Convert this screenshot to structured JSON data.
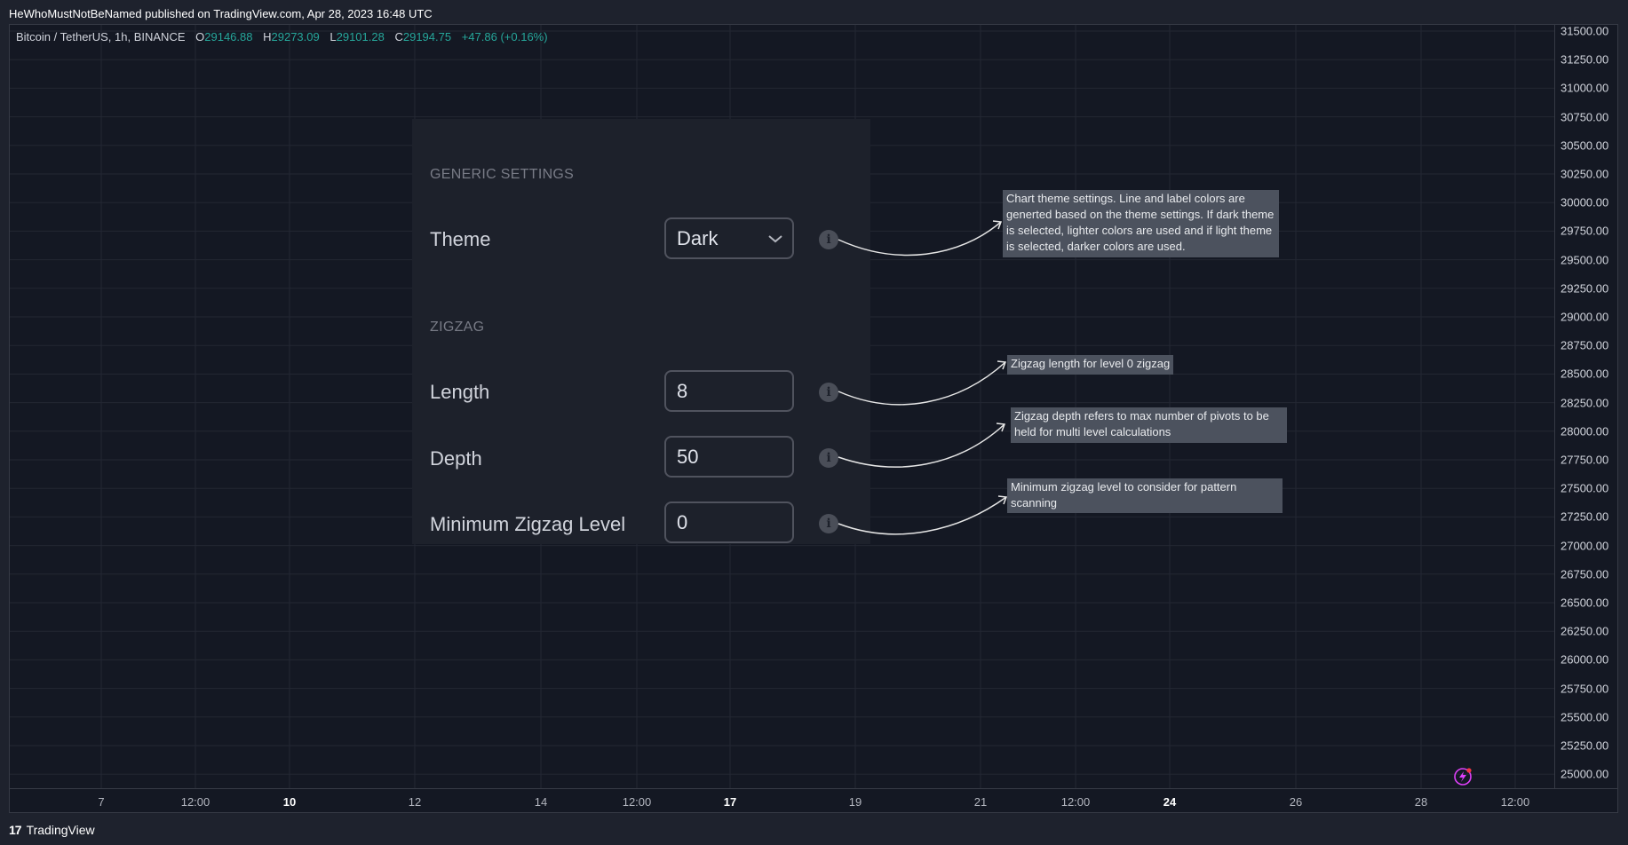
{
  "header": {
    "text": "HeWhoMustNotBeNamed published on TradingView.com, Apr 28, 2023 16:48 UTC"
  },
  "legend": {
    "symbol": "Bitcoin / TetherUS, 1h, BINANCE",
    "open_key": "O",
    "open_value": "29146.88",
    "high_key": "H",
    "high_value": "29273.09",
    "low_key": "L",
    "low_value": "29101.28",
    "close_key": "C",
    "close_value": "29194.75",
    "change": "+47.86 (+0.16%)"
  },
  "price_axis": [
    "31500.00",
    "31250.00",
    "31000.00",
    "30750.00",
    "30500.00",
    "30250.00",
    "30000.00",
    "29750.00",
    "29500.00",
    "29250.00",
    "29000.00",
    "28750.00",
    "28500.00",
    "28250.00",
    "28000.00",
    "27750.00",
    "27500.00",
    "27250.00",
    "27000.00",
    "26750.00",
    "26500.00",
    "26250.00",
    "26000.00",
    "25750.00",
    "25500.00",
    "25250.00",
    "25000.00"
  ],
  "time_axis": [
    {
      "label": "7",
      "bold": false
    },
    {
      "label": "12:00",
      "bold": false
    },
    {
      "label": "10",
      "bold": true
    },
    {
      "label": "12",
      "bold": false
    },
    {
      "label": "14",
      "bold": false
    },
    {
      "label": "12:00",
      "bold": false
    },
    {
      "label": "17",
      "bold": true
    },
    {
      "label": "19",
      "bold": false
    },
    {
      "label": "21",
      "bold": false
    },
    {
      "label": "12:00",
      "bold": false
    },
    {
      "label": "24",
      "bold": true
    },
    {
      "label": "26",
      "bold": false
    },
    {
      "label": "28",
      "bold": false
    },
    {
      "label": "12:00",
      "bold": false
    }
  ],
  "settings": {
    "generic_title": "GENERIC SETTINGS",
    "theme_label": "Theme",
    "theme_value": "Dark",
    "zigzag_title": "ZIGZAG",
    "length_label": "Length",
    "length_value": "8",
    "depth_label": "Depth",
    "depth_value": "50",
    "min_level_label": "Minimum Zigzag Level",
    "min_level_value": "0",
    "info_glyph": "i"
  },
  "tooltips": {
    "theme": "Chart theme settings. Line and label colors are generted based on the theme settings. If dark theme is selected, lighter colors are used and if light theme is selected, darker colors are used.",
    "length": "Zigzag length for level 0 zigzag",
    "depth": "Zigzag depth refers to max number of pivots to be held for multi level calculations",
    "min_level": "Minimum zigzag level to consider for pattern scanning"
  },
  "footer": {
    "logo_text": "TradingView",
    "logo_glyph": "17"
  },
  "colors": {
    "background": "#1e222d",
    "chart_bg": "#141823",
    "panel_bg": "#1d212b",
    "positive": "#26a69a",
    "tooltip_bg": "#4c525e",
    "lightning": "#e040fb"
  },
  "icons": [
    "chevron-down-icon",
    "info-icon",
    "lightning-icon",
    "tradingview-logo-icon"
  ]
}
